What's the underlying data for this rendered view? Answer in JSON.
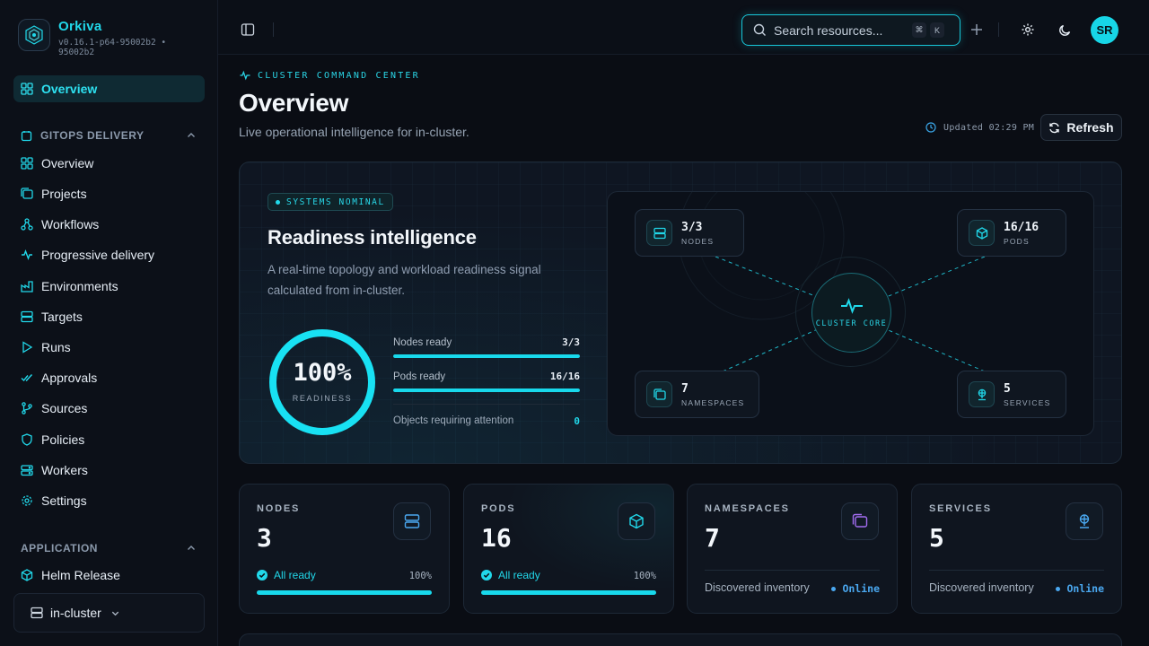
{
  "brand": {
    "name": "Orkiva",
    "version": "v0.16.1-p64-95002b2 • 95002b2"
  },
  "sidebar": {
    "top_item": {
      "label": "Overview",
      "icon": "grid-icon"
    },
    "sections": [
      {
        "title": "GITOPS DELIVERY",
        "items": [
          {
            "label": "Overview",
            "icon": "grid-icon"
          },
          {
            "label": "Projects",
            "icon": "folders-icon"
          },
          {
            "label": "Workflows",
            "icon": "workflow-icon"
          },
          {
            "label": "Progressive delivery",
            "icon": "pulse-icon"
          },
          {
            "label": "Environments",
            "icon": "factory-icon"
          },
          {
            "label": "Targets",
            "icon": "server-icon"
          },
          {
            "label": "Runs",
            "icon": "play-icon"
          },
          {
            "label": "Approvals",
            "icon": "check-double-icon"
          },
          {
            "label": "Sources",
            "icon": "git-branch-icon"
          },
          {
            "label": "Policies",
            "icon": "shield-icon"
          },
          {
            "label": "Workers",
            "icon": "workers-icon"
          },
          {
            "label": "Settings",
            "icon": "gear-icon"
          }
        ]
      },
      {
        "title": "APPLICATION",
        "items": [
          {
            "label": "Helm Release",
            "icon": "package-icon"
          }
        ]
      }
    ],
    "cluster_selector": {
      "value": "in-cluster"
    }
  },
  "topbar": {
    "search_placeholder": "Search resources...",
    "shortcut_keys": [
      "⌘",
      "K"
    ],
    "avatar_initials": "SR"
  },
  "header": {
    "eyebrow": "CLUSTER COMMAND CENTER",
    "title": "Overview",
    "subtitle": "Live operational intelligence for in-cluster.",
    "updated": "Updated 02:29 PM",
    "refresh_label": "Refresh"
  },
  "hero": {
    "status_pill": "SYSTEMS NOMINAL",
    "title": "Readiness intelligence",
    "description": "A real-time topology and workload readiness signal calculated from in-cluster.",
    "readiness": {
      "value": "100%",
      "label": "READINESS",
      "fraction": 1.0
    },
    "meters": [
      {
        "label": "Nodes ready",
        "value": "3/3",
        "fraction": 1.0
      },
      {
        "label": "Pods ready",
        "value": "16/16",
        "fraction": 1.0
      }
    ],
    "attention": {
      "label": "Objects requiring attention",
      "value": "0"
    },
    "topology": {
      "core_label": "CLUSTER CORE",
      "nodes": [
        {
          "value": "3/3",
          "label": "NODES",
          "icon": "server-icon"
        },
        {
          "value": "16/16",
          "label": "PODS",
          "icon": "cube-icon"
        },
        {
          "value": "7",
          "label": "NAMESPACES",
          "icon": "folders-icon"
        },
        {
          "value": "5",
          "label": "SERVICES",
          "icon": "network-icon"
        }
      ]
    }
  },
  "stats": [
    {
      "label": "NODES",
      "value": "3",
      "status": "All ready",
      "percent": "100%",
      "fraction": 1.0,
      "icon": "server-icon",
      "icon_color": "#4aa8f0"
    },
    {
      "label": "PODS",
      "value": "16",
      "status": "All ready",
      "percent": "100%",
      "fraction": 1.0,
      "icon": "cube-icon",
      "icon_color": "#21d8ea"
    },
    {
      "label": "NAMESPACES",
      "value": "7",
      "note": "Discovered inventory",
      "state": "Online",
      "icon": "folders-icon",
      "icon_color": "#a26cf0"
    },
    {
      "label": "SERVICES",
      "value": "5",
      "note": "Discovered inventory",
      "state": "Online",
      "icon": "network-icon",
      "icon_color": "#4aa8f0"
    }
  ],
  "colors": {
    "accent": "#21d8ea",
    "online": "#4aa8f0",
    "background": "#0a0d14"
  }
}
